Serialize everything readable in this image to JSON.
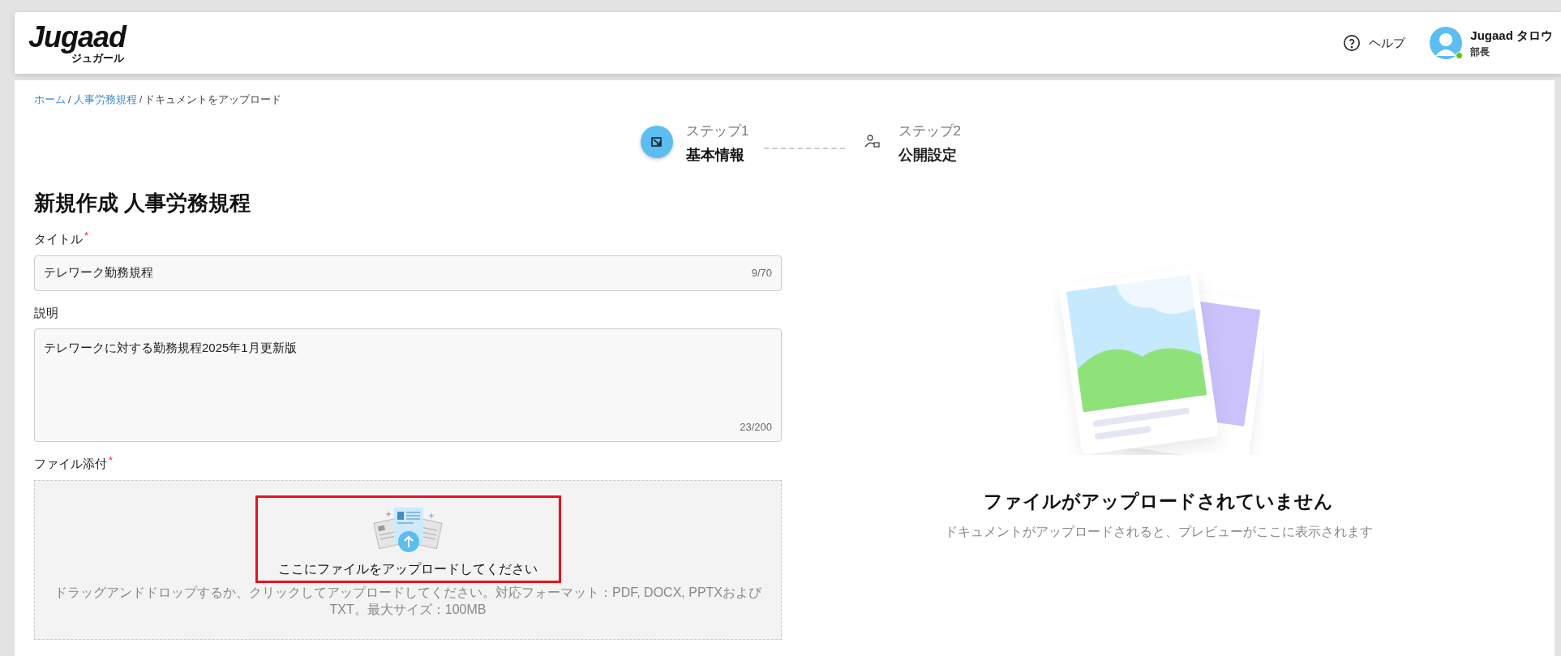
{
  "header": {
    "logo": "Jugaad",
    "logo_sub": "ジュガール",
    "help": "ヘルプ",
    "user": {
      "name": "Jugaad タロウ",
      "role": "部長",
      "online": true
    }
  },
  "breadcrumb_separator": "/",
  "breadcrumb": [
    {
      "label": "ホーム",
      "link": true
    },
    {
      "label": "人事労務規程",
      "link": true
    },
    {
      "label": "ドキュメントをアップロード",
      "link": false
    }
  ],
  "steps": [
    {
      "step": "ステップ1",
      "name": "基本情報",
      "selected": true
    },
    {
      "step": "ステップ2",
      "name": "公開設定",
      "selected": false
    }
  ],
  "page_title": "新規作成 人事労務規程",
  "fields": [
    {
      "kind": "input",
      "label": "タイトル",
      "mark": "*",
      "value": "テレワーク勤務規程",
      "counter": "9/70"
    },
    {
      "kind": "textarea",
      "label": "説明",
      "value": "テレワークに対する勤務規程2025年1月更新版",
      "counter": "23/200"
    }
  ],
  "upload": {
    "label": "ファイル添付",
    "mark": "*",
    "prompt": "ここにファイルをアップロードしてください",
    "hint": "ドラッグアンドドロップするか、クリックしてアップロードしてください。対応フォーマット：PDF, DOCX, PPTXおよびTXT。最大サイズ：100MB",
    "highlighted": true
  },
  "preview": {
    "title": "ファイルがアップロードされていません",
    "subtitle": "ドキュメントがアップロードされると、プレビューがここに表示されます"
  }
}
